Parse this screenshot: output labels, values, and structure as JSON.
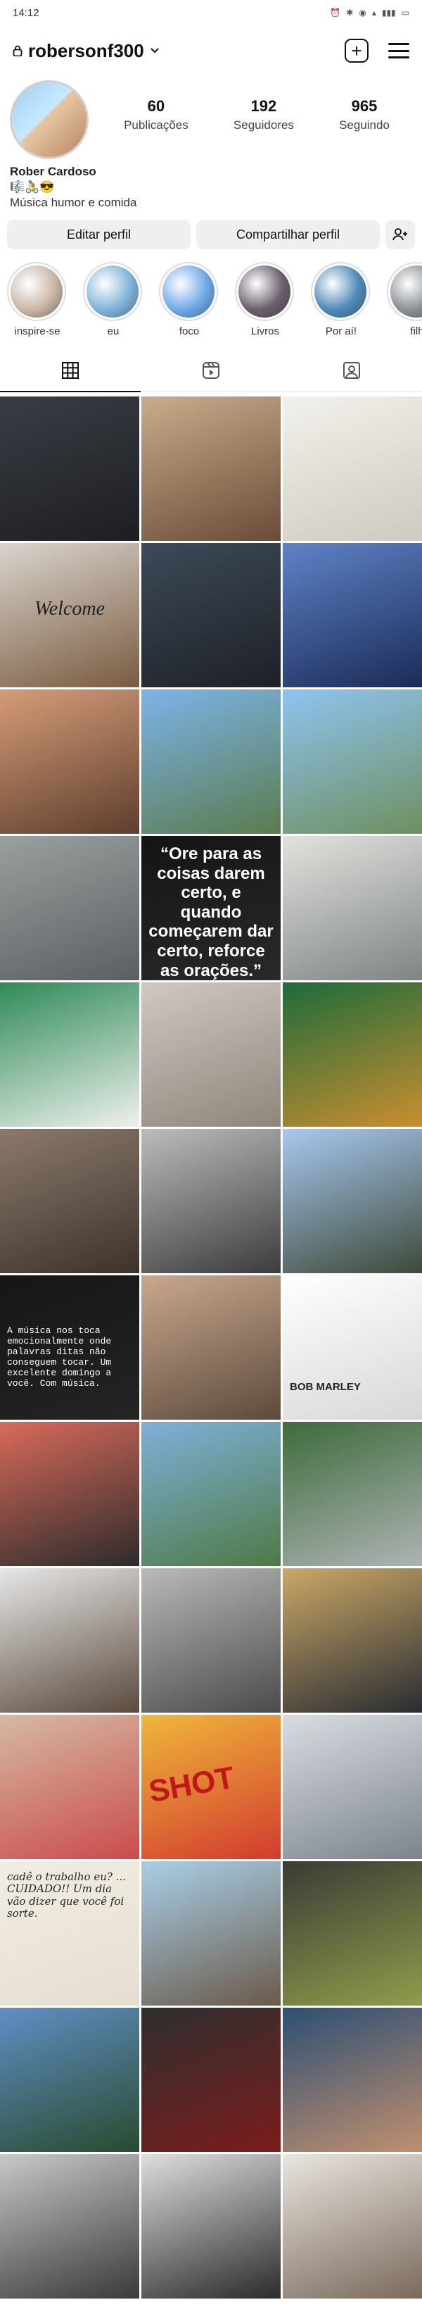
{
  "status": {
    "time": "14:12",
    "icons": [
      "alarm-icon",
      "bluetooth-icon",
      "eye-icon",
      "wifi-speed-icon",
      "signal-4g-icon",
      "battery-icon"
    ]
  },
  "header": {
    "username": "robersonf300",
    "icons": [
      "lock-icon",
      "chevron-down-icon",
      "add-post-icon",
      "menu-icon"
    ]
  },
  "profile": {
    "posts_count": "60",
    "posts_label": "Publicações",
    "followers_count": "192",
    "followers_label": "Seguidores",
    "following_count": "965",
    "following_label": "Seguindo",
    "display_name": "Rober Cardoso",
    "bio_emojis": "🎼🚴😎",
    "bio_text": "Música humor e comida"
  },
  "actions": {
    "edit_profile": "Editar perfil",
    "share_profile": "Compartilhar perfil",
    "discover_icon": "add-person-icon"
  },
  "highlights": [
    {
      "label": "inspire-se",
      "color": "#c9b6a7"
    },
    {
      "label": "eu",
      "color": "#7fb3d9"
    },
    {
      "label": "foco",
      "color": "#6fa8e8"
    },
    {
      "label": "Livros",
      "color": "#6b5e6e"
    },
    {
      "label": "Por aí!",
      "color": "#4d8ab8"
    },
    {
      "label": "filh",
      "color": "#8a8f95"
    }
  ],
  "tabs": [
    "grid-icon",
    "reels-icon",
    "tagged-icon"
  ],
  "grid": [
    {
      "colors": [
        "#3a3d44",
        "#1c1e22"
      ],
      "text": ""
    },
    {
      "colors": [
        "#c9ad8b",
        "#6b4b38"
      ],
      "text": ""
    },
    {
      "colors": [
        "#f3f1ec",
        "#cfcac0"
      ],
      "text": ""
    },
    {
      "colors": [
        "#d9d4cd",
        "#7a5b40"
      ],
      "text": "Welcome"
    },
    {
      "colors": [
        "#3d4a59",
        "#1e2026"
      ],
      "text": ""
    },
    {
      "colors": [
        "#5f83c6",
        "#1b2b58"
      ],
      "text": ""
    },
    {
      "colors": [
        "#d59c78",
        "#5e3e2e"
      ],
      "text": ""
    },
    {
      "colors": [
        "#7cb4e7",
        "#5b7b4e"
      ],
      "text": ""
    },
    {
      "colors": [
        "#8ec4ef",
        "#6f8f60"
      ],
      "text": ""
    },
    {
      "colors": [
        "#9aa0a0",
        "#5a5f61"
      ],
      "text": ""
    },
    {
      "colors": [
        "#141414",
        "#2a2a2a"
      ],
      "text": "“Ore para as coisas darem certo, e quando começarem dar certo, reforce as orações.”"
    },
    {
      "colors": [
        "#e2e2de",
        "#7e8583"
      ],
      "text": ""
    },
    {
      "colors": [
        "#2f8a58",
        "#eef0ed"
      ],
      "text": ""
    },
    {
      "colors": [
        "#cfc9c3",
        "#8f857b"
      ],
      "text": ""
    },
    {
      "colors": [
        "#1d6b3a",
        "#c98e2f"
      ],
      "text": ""
    },
    {
      "colors": [
        "#8b7a6b",
        "#3d332b"
      ],
      "text": ""
    },
    {
      "colors": [
        "#bcbcbc",
        "#3c3c3c"
      ],
      "text": ""
    },
    {
      "colors": [
        "#a8c8ef",
        "#3e4a3a"
      ],
      "text": ""
    },
    {
      "colors": [
        "#161616",
        "#242424"
      ],
      "text": "A música nos toca emocionalmente onde palavras ditas não conseguem tocar. Um excelente domingo a você. Com música."
    },
    {
      "colors": [
        "#c9a88e",
        "#5d4a3c"
      ],
      "text": ""
    },
    {
      "colors": [
        "#ffffff",
        "#d7d7d7"
      ],
      "text": "BOB MARLEY"
    },
    {
      "colors": [
        "#d86a5a",
        "#2c2c2c"
      ],
      "text": ""
    },
    {
      "colors": [
        "#7fb0d8",
        "#4e7a45"
      ],
      "text": ""
    },
    {
      "colors": [
        "#3e6b3b",
        "#aeb3b4"
      ],
      "text": ""
    },
    {
      "colors": [
        "#e7e7e7",
        "#5a4a3d"
      ],
      "text": ""
    },
    {
      "colors": [
        "#b9b9b9",
        "#4b4b4b"
      ],
      "text": ""
    },
    {
      "colors": [
        "#caa867",
        "#2a2d33"
      ],
      "text": ""
    },
    {
      "colors": [
        "#d6b9a3",
        "#c94c4c"
      ],
      "text": ""
    },
    {
      "colors": [
        "#f0b73a",
        "#d13b2f"
      ],
      "text": "SHOT"
    },
    {
      "colors": [
        "#d9dde2",
        "#7d848c"
      ],
      "text": ""
    },
    {
      "colors": [
        "#f1ede4",
        "#e6ddd0"
      ],
      "text": "cadê o trabalho eu? ... CUIDADO!! Um dia vão dizer que você foi sorte."
    },
    {
      "colors": [
        "#a9cfe8",
        "#6a5a4a"
      ],
      "text": ""
    },
    {
      "colors": [
        "#3b3b35",
        "#8f9d4a"
      ],
      "text": ""
    },
    {
      "colors": [
        "#5f8fc4",
        "#2a4a2e"
      ],
      "text": ""
    },
    {
      "colors": [
        "#2f2f2f",
        "#7b1c1c"
      ],
      "text": ""
    },
    {
      "colors": [
        "#2d4f73",
        "#c08f6e"
      ],
      "text": ""
    },
    {
      "colors": [
        "#c8c8c8",
        "#3a3a3a"
      ],
      "text": ""
    },
    {
      "colors": [
        "#dedede",
        "#2b2b2b"
      ],
      "text": ""
    },
    {
      "colors": [
        "#e9e5df",
        "#7b6a5c"
      ],
      "text": ""
    }
  ]
}
